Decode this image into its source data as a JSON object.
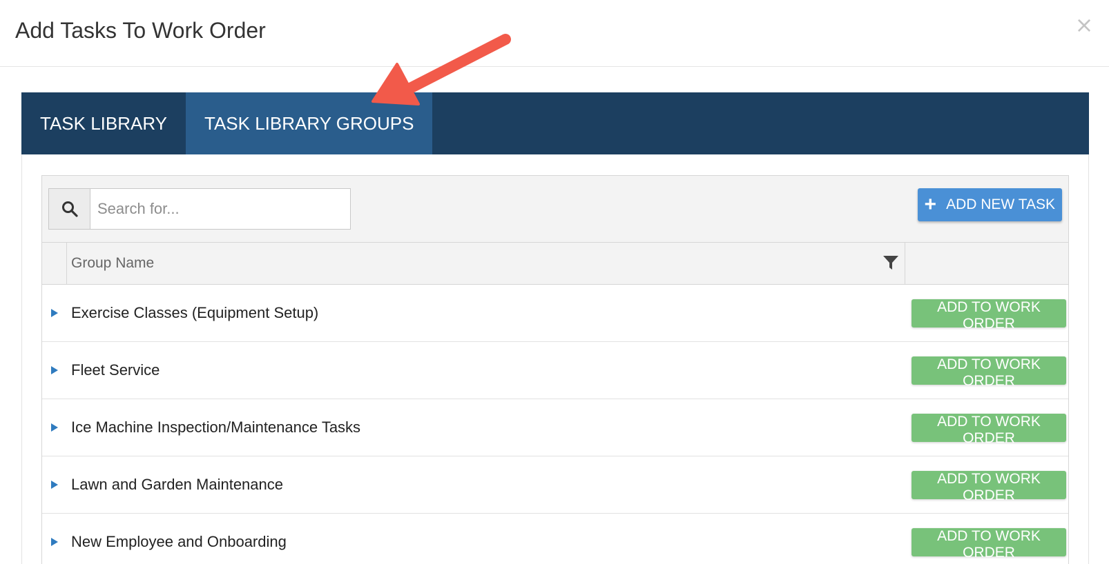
{
  "modal": {
    "title": "Add Tasks To Work Order",
    "close_label": "×"
  },
  "tabs": [
    {
      "label": "TASK LIBRARY",
      "active": false
    },
    {
      "label": "TASK LIBRARY GROUPS",
      "active": true
    }
  ],
  "toolbar": {
    "search_placeholder": "Search for...",
    "search_value": "",
    "add_new_task_label": "ADD NEW TASK"
  },
  "grid": {
    "columns": [
      "Group Name"
    ],
    "rows": [
      {
        "name": "Exercise Classes (Equipment Setup)",
        "action": "ADD TO WORK ORDER"
      },
      {
        "name": "Fleet Service",
        "action": "ADD TO WORK ORDER"
      },
      {
        "name": "Ice Machine Inspection/Maintenance Tasks",
        "action": "ADD TO WORK ORDER"
      },
      {
        "name": "Lawn and Garden Maintenance",
        "action": "ADD TO WORK ORDER"
      },
      {
        "name": "New Employee and Onboarding",
        "action": "ADD TO WORK ORDER"
      }
    ]
  },
  "icons": {
    "search": "search-icon",
    "plus": "plus-icon",
    "filter": "filter-icon",
    "expand": "caret-right-icon",
    "close": "close-icon",
    "annotation": "annotation-arrow"
  },
  "colors": {
    "tab_bar": "#1c3f60",
    "tab_active": "#2a5d8c",
    "primary_button": "#4a90d6",
    "success_button": "#78c27a",
    "expand_arrow": "#2f7bbf",
    "annotation_arrow": "#f25a4a"
  }
}
